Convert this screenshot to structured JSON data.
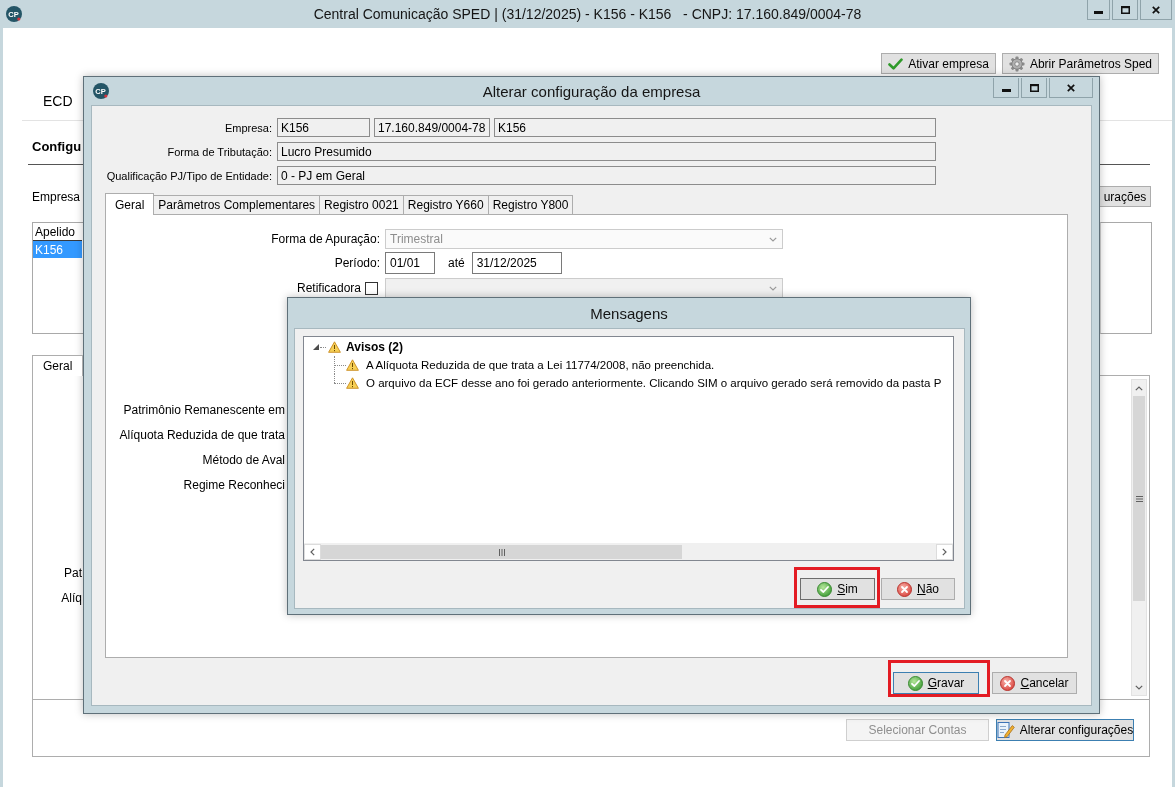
{
  "main_window": {
    "logo": "CP",
    "title": "Central Comunicação SPED | (31/12/2025) - K156 - K156   - CNPJ: 17.160.849/0004-78",
    "activate_button": {
      "label": "Ativar empresa"
    },
    "sped_params_button": {
      "label": "Abrir Parâmetros Sped"
    },
    "module_tab": "ECD",
    "heading": "Configu",
    "company_label": "Empresa",
    "settings_button": {
      "label": "urações"
    },
    "companies": {
      "columns": [
        "Apelido"
      ],
      "rows": [
        {
          "cells": [
            "K156"
          ],
          "selected": true
        }
      ]
    },
    "lower_tabs": [
      {
        "label": "Geral",
        "selected": true
      }
    ],
    "lower_labels": [
      "Pat",
      "Alíq"
    ],
    "select_accounts_button": {
      "label": "Selecionar Contas",
      "disabled": true
    },
    "change_settings_button": {
      "label": "Alterar configurações",
      "disabled": false,
      "focused": true
    }
  },
  "config_dialog": {
    "logo": "CP",
    "title": "Alterar configuração da empresa",
    "fields": [
      {
        "label": "Empresa:",
        "values": [
          "K156",
          "17.160.849/0004-78",
          "K156"
        ]
      },
      {
        "label": "Forma de Tributação:",
        "values": [
          "Lucro Presumido"
        ]
      },
      {
        "label": "Qualificação PJ/Tipo de Entidade:",
        "values": [
          "0 - PJ em Geral"
        ]
      }
    ],
    "tabs": [
      {
        "label": "Geral",
        "selected": true
      },
      {
        "label": "Parâmetros Complementares",
        "selected": false
      },
      {
        "label": "Registro 0021",
        "selected": false
      },
      {
        "label": "Registro Y660",
        "selected": false
      },
      {
        "label": "Registro Y800",
        "selected": false
      }
    ],
    "apuracao": {
      "label": "Forma de Apuração:",
      "value": "Trimestral",
      "disabled": true
    },
    "periodo": {
      "label": "Período:",
      "start": "01/01",
      "separator": "até",
      "end": "31/12/2025"
    },
    "retificadora": {
      "label": "Retificadora",
      "checked": false,
      "combo_disabled": true
    },
    "partial_labels": [
      "Patrimônio Remanescente em",
      "Alíquota Reduzida de que trata",
      "Método de Aval",
      "Regime Reconheci"
    ],
    "save_button": {
      "label": "Gravar",
      "focused": true,
      "highlighted": true
    },
    "cancel_button": {
      "label": "Cancelar",
      "focused": false,
      "highlighted": false
    }
  },
  "messages_dialog": {
    "title": "Mensagens",
    "tree": [
      {
        "label": "Avisos (2)",
        "expanded": true,
        "children": [
          {
            "label": "A Alíquota Reduzida de que trata a Lei 11774/2008, não preenchida."
          },
          {
            "label": "O arquivo da ECF desse ano foi gerado anteriormente. Clicando SIM o arquivo gerado será removido da pasta P"
          }
        ]
      }
    ],
    "yes_button": {
      "label": "Sim",
      "focused": true,
      "highlighted": true
    },
    "no_button": {
      "label": "Não",
      "focused": false,
      "highlighted": false
    }
  }
}
